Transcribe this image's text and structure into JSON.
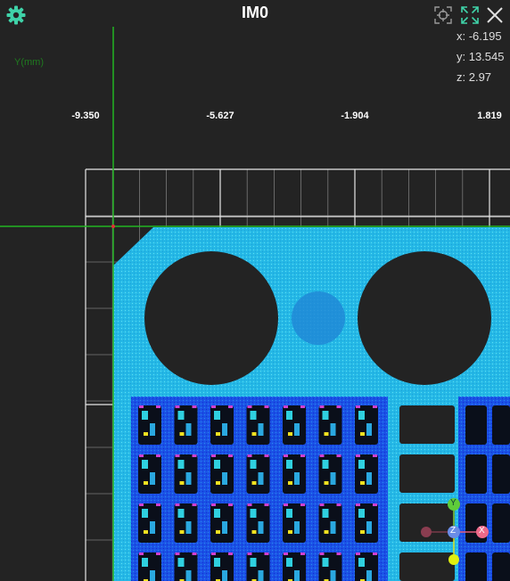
{
  "viewer": {
    "title": "IM0",
    "axis_label": "Y(mm)",
    "ticks": [
      "-9.350",
      "-5.627",
      "-1.904",
      "1.819"
    ],
    "coords": {
      "x": "x: -6.195",
      "y": "y: 13.545",
      "z": "z: 2.97"
    },
    "icons": {
      "settings": "gear-icon",
      "fit_view": "fit-view-icon",
      "maximize": "maximize-icon",
      "close": "close-icon"
    },
    "gizmo_axes": [
      "Y",
      "Z",
      "X"
    ],
    "colors": {
      "background": "#232323",
      "accent": "#3fd2a8",
      "crosshair": "#22b422",
      "pointcloud": "#29b6e8",
      "pointcloud_dark": "#1740e0"
    }
  }
}
